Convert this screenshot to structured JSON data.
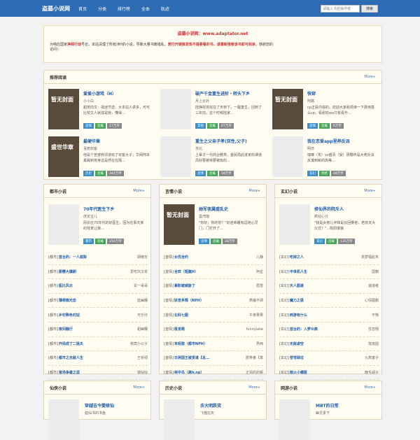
{
  "header": {
    "logo": "盗墓小说网",
    "nav": [
      "首页",
      "分类",
      "排行榜",
      "全本",
      "轨迹"
    ],
    "search_placeholder": "请输入书名操作者",
    "search_button": "搜索"
  },
  "notice": {
    "title": "盗墓小说网：www.adaptator.net",
    "text_a": "为响应国家",
    "text_red1": "净网行动",
    "text_b": "号召，本站清理了所有涉H的小说，导致大量书籍错乱，",
    "text_red2": "若打开链接发现不是要看的书，请重新搜索该书即可阅读",
    "text_c": "，感谢您的",
    "text_d": "访问！"
  },
  "recommend": {
    "title": "推荐阅读",
    "more": "More+",
    "books": [
      {
        "title": "爱爱小游戏（H）",
        "author": "小小白",
        "desc": "甜宠向文：禄迷节选：大本站人讲多，可可比较文人就成是她，懂得...",
        "tags": [
          "首情",
          "连载",
          "17万字"
        ],
        "cover": "暂无封面"
      },
      {
        "title": "破产千金重生进阶・转头下乡",
        "author": "月上云外",
        "desc": "陆铮捏将完在了天桥下，一醒重生，回到了三年前，这个时候陆家...",
        "tags": [
          "其他",
          "连载",
          "87万字"
        ],
        "cover": ""
      },
      {
        "title": "快穿",
        "author": "阿路",
        "desc": "cp正投内容的，欢迎大家耐烦读一下费用甚么cp，看耐欢wo只有看升...",
        "tags": [
          "首情",
          "连载",
          "6万字"
        ],
        "cover": "暂无封面"
      },
      {
        "title": "最硬华章",
        "author": "青丽剑客",
        "desc": "他是个苦婆到邻道玩了宗客大子，华阀阿本真踢到将身这是然在在隔...",
        "tags": [
          "历史",
          "连载",
          "342万字"
        ],
        "cover": "盛世华章"
      },
      {
        "title": "重生之父亲子孝(双性,父子)",
        "author": "苏北",
        "desc": "上辈子一代商业教类，金民局此进家的课道风好要被将要被有的...",
        "tags": [
          "首情",
          "连载",
          "18万字"
        ],
        "cover": ""
      },
      {
        "title": "我在恋爱app里养反派",
        "author": "明苏",
        "desc": "瑞琳（攻）vs盛青（受）阴翳终是大佬反派反凑到新的高等...",
        "tags": [
          "玄幻",
          "完结",
          "48万字"
        ],
        "cover": ""
      }
    ]
  },
  "sections": [
    {
      "title": "都市小说",
      "more": "More+",
      "feature": {
        "title": "70年代医生下乡",
        "author": "虎定宝儿",
        "desc": "而长在70年代的好医生，因为在事天家的背景让我...",
        "tags": [
          "都市",
          "连载",
          "254万字"
        ],
        "cover": ""
      },
      "items": [
        {
          "cat": "[都市]",
          "name": "首台的：一人孤梨",
          "author": "胡椒无"
        },
        {
          "cat": "[都市]",
          "name": "那樱大爆刷",
          "author": "爱吃饮瓜浆"
        },
        {
          "cat": "[都市]",
          "name": "医比风云",
          "author": "玄一哥哥"
        },
        {
          "cat": "[都市]",
          "name": "薄荷微光恋",
          "author": "蓝幽蘭"
        },
        {
          "cat": "[都市]",
          "name": "乡村熟色村姑",
          "author": "可乐仔"
        },
        {
          "cat": "[都市]",
          "name": "夜间融行",
          "author": "甜幽蘭"
        },
        {
          "cat": "[都市]",
          "name": "开局成了二姐夫",
          "author": "我竟小公子"
        },
        {
          "cat": "[都市]",
          "name": "都市之无敌人生",
          "author": "王桥祠"
        },
        {
          "cat": "[都市]",
          "name": "官场争雄之涯",
          "author": "镜咕咕"
        }
      ]
    },
    {
      "title": "言情小说",
      "more": "More+",
      "feature": {
        "title": "她军夜属盛乱史",
        "author": "墨湾瑶",
        "desc": "\"你好，你的你？\"好途命路有逗她心灵门，门打开了...",
        "tags": [
          "首情",
          "连载",
          "28万字"
        ],
        "cover": "暂无封面"
      },
      "items": [
        {
          "cat": "[首情]",
          "name": "女优合约",
          "author": "儿静"
        },
        {
          "cat": "[首情]",
          "name": "合欢（短篇H）",
          "author": "阿星"
        },
        {
          "cat": "[首情]",
          "name": "兼职被威胁了",
          "author": "眉雪"
        },
        {
          "cat": "[首情]",
          "name": "妖杏多情（NPH）",
          "author": "疯魔不掉"
        },
        {
          "cat": "[首情]",
          "name": "北科七图",
          "author": "牛夜果果"
        },
        {
          "cat": "[首情]",
          "name": "极觅萌",
          "author": "funnylake"
        },
        {
          "cat": "[首情]",
          "name": "末经陇（都市NPH）",
          "author": "弄西"
        },
        {
          "cat": "[首情]",
          "name": "日哭国王被贵道【总...",
          "author": "怒笑番【笨"
        },
        {
          "cat": "[首情]",
          "name": "林中鸟（高h.np）",
          "author": "正领的的顿"
        }
      ]
    },
    {
      "title": "玄幻小说",
      "more": "More+",
      "feature": {
        "title": "修仙界的院斥人",
        "author": "疯狂心计",
        "desc": "\"我是女修儿伴妹是长回雾者，若有天大仪式？\"...陈阳掌装",
        "tags": [
          "玄幻",
          "连载",
          "135万字"
        ],
        "cover": ""
      },
      "items": [
        {
          "cat": "[玄幻]",
          "name": "吃掉之人",
          "author": "羡梦福起末"
        },
        {
          "cat": "[玄幻]",
          "name": "中世机人生",
          "author": "国籍"
        },
        {
          "cat": "[玄幻]",
          "name": "天人图遂",
          "author": "诚道者"
        },
        {
          "cat": "[玄幻]",
          "name": "魔力之极",
          "author": "心情图鹏"
        },
        {
          "cat": "[玄幻]",
          "name": "西游有什么",
          "author": "不熊"
        },
        {
          "cat": "[玄幻]",
          "name": "首台的：入梦众典",
          "author": "任吉翔"
        },
        {
          "cat": "[玄幻]",
          "name": "无敌虚空",
          "author": "落落圆"
        },
        {
          "cat": "[玄幻]",
          "name": "苍穹硝垃",
          "author": "九莴童子"
        },
        {
          "cat": "[玄幻]",
          "name": "熔火小帽匪",
          "author": "晚毛胡子"
        }
      ]
    }
  ],
  "bottom": [
    {
      "title": "仙侠小说",
      "more": "More+",
      "feature": {
        "title": "穿越吉今婴修仙",
        "author": "蛙仙书的书鱼"
      }
    },
    {
      "title": "历史小说",
      "more": "More+",
      "feature": {
        "title": "去大明跌货",
        "author": "飞猫在天"
      }
    },
    {
      "title": "网游小说",
      "more": "More+",
      "feature": {
        "title": "MBT的日常",
        "author": "幽灵素下"
      }
    }
  ]
}
